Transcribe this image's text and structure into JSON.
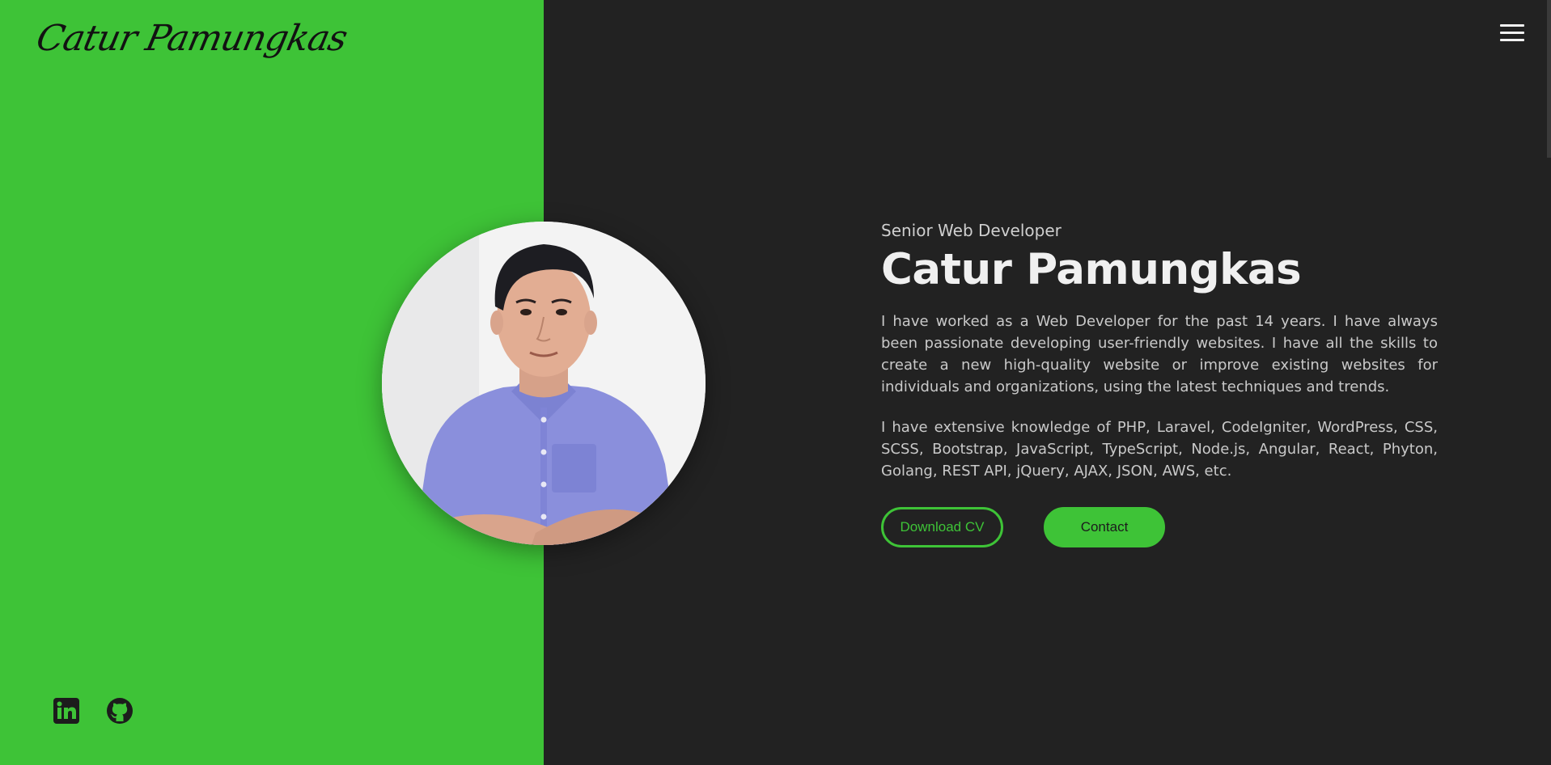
{
  "header": {
    "logo_text": "Catur Pamungkas",
    "menu_icon": "hamburger-menu-icon"
  },
  "hero": {
    "subtitle": "Senior Web Developer",
    "name": "Catur Pamungkas",
    "paragraphs": [
      "I have worked as a Web Developer for the past 14 years. I have always been passionate developing user-friendly websites. I have all the skills to create a new high-quality website or improve existing websites for individuals and organizations, using the latest techniques and trends.",
      "I have extensive knowledge of PHP, Laravel, CodeIgniter, WordPress, CSS, SCSS, Bootstrap, JavaScript, TypeScript, Node.js, Angular, React, Phyton, Golang, REST API, jQuery, AJAX, JSON, AWS, etc."
    ],
    "buttons": {
      "download_cv": "Download CV",
      "contact": "Contact"
    }
  },
  "social": [
    {
      "icon": "linkedin-icon"
    },
    {
      "icon": "github-icon"
    }
  ],
  "colors": {
    "accent": "#3ec337",
    "background": "#222222",
    "heading": "#f0f0f0",
    "text": "#c9c9c9"
  }
}
